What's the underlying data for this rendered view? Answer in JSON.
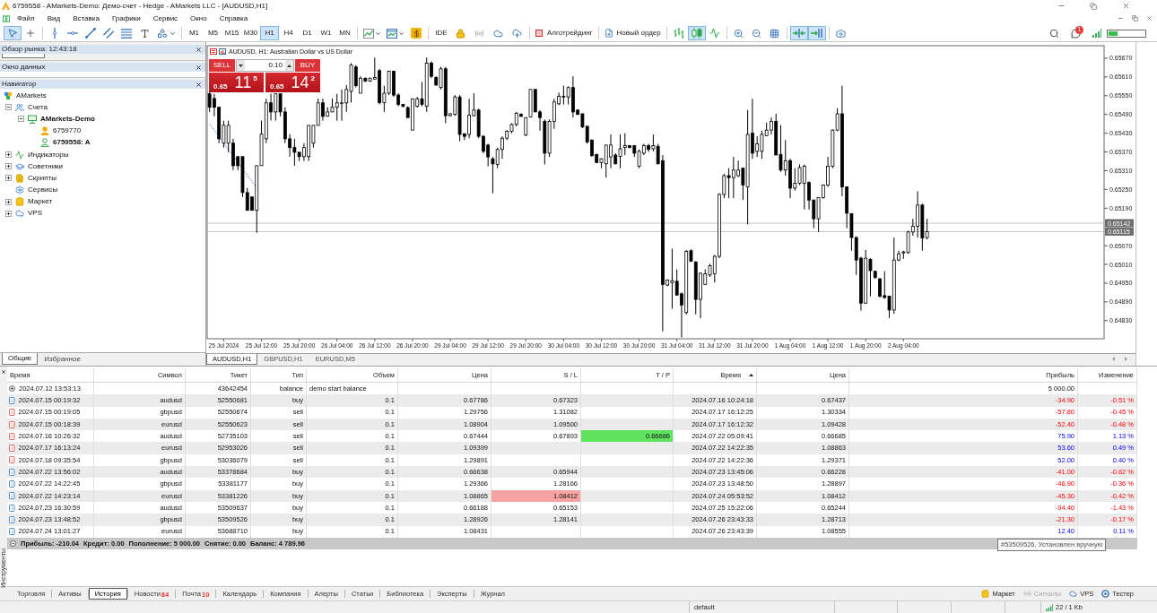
{
  "window": {
    "title": "6759558 - AMarkets-Demo: Демо-счет - Hedge - AMarkets LLC - [AUDUSD,H1]"
  },
  "menu": [
    "Файл",
    "Вид",
    "Вставка",
    "Графики",
    "Сервис",
    "Окно",
    "Справка"
  ],
  "toolbar": {
    "tools": [
      {
        "kind": "cursor",
        "selected": true
      },
      {
        "kind": "crosshair",
        "selected": false
      },
      {
        "kind": "vline",
        "selected": false
      },
      {
        "kind": "hline",
        "selected": false
      },
      {
        "kind": "trend",
        "selected": false
      },
      {
        "kind": "channel",
        "selected": false
      },
      {
        "kind": "fibo",
        "selected": false
      },
      {
        "kind": "text",
        "selected": false
      },
      {
        "kind": "shapes",
        "selected": false
      }
    ],
    "timeframes": [
      {
        "label": "M1",
        "selected": false
      },
      {
        "label": "M5",
        "selected": false
      },
      {
        "label": "M15",
        "selected": false
      },
      {
        "label": "M30",
        "selected": false
      },
      {
        "label": "H1",
        "selected": true
      },
      {
        "label": "H4",
        "selected": false
      },
      {
        "label": "D1",
        "selected": false
      },
      {
        "label": "W1",
        "selected": false
      },
      {
        "label": "MN",
        "selected": false
      }
    ],
    "ide": "IDE",
    "algo_trading": {
      "label": "Алготрейдинг",
      "on": false
    },
    "new_order": "Новый ордер",
    "chart_types": [
      {
        "kind": "bars",
        "selected": false
      },
      {
        "kind": "candles",
        "selected": true
      },
      {
        "kind": "line",
        "selected": false
      }
    ],
    "view_toggles": [
      {
        "kind": "autoscroll",
        "selected": true
      },
      {
        "kind": "shift",
        "selected": true
      }
    ],
    "notifications": "1"
  },
  "market_watch": {
    "title": "Обзор рынка: 12:43:18"
  },
  "data_window": {
    "title": "Окно данных"
  },
  "navigator": {
    "title": "Навигатор",
    "tree": [
      {
        "label": "AMarkets",
        "kind": "broker",
        "children": [
          {
            "label": "Счета",
            "kind": "accounts",
            "expanded": true,
            "children": [
              {
                "label": "AMarkets-Demo",
                "kind": "server",
                "expanded": true,
                "active": true,
                "children": [
                  {
                    "label": "6759770",
                    "kind": "account",
                    "active": false
                  },
                  {
                    "label": "6759558: A",
                    "kind": "account",
                    "active": true
                  }
                ]
              }
            ]
          },
          {
            "label": "Индикаторы",
            "kind": "indicators",
            "expanded": false
          },
          {
            "label": "Советники",
            "kind": "experts",
            "expanded": false
          },
          {
            "label": "Скрипты",
            "kind": "scripts",
            "expanded": false
          },
          {
            "label": "Сервисы",
            "kind": "services"
          },
          {
            "label": "Маркет",
            "kind": "market",
            "expanded": false
          },
          {
            "label": "VPS",
            "kind": "vps",
            "expanded": false
          }
        ]
      }
    ]
  },
  "left_tabs": [
    {
      "label": "Общие",
      "selected": true
    },
    {
      "label": "Избранное",
      "selected": false
    }
  ],
  "chart": {
    "one_click": {
      "sell": "SELL",
      "buy": "BUY",
      "lot": "0.10",
      "sell_price": {
        "head": "0.65",
        "big": "11",
        "tail": "5"
      },
      "buy_price": {
        "head": "0.65",
        "big": "14",
        "tail": "2"
      }
    },
    "chart_data": [
      {
        "type": "candlestick",
        "title": "AUDUSD, H1: Australian Dollar vs US Dollar",
        "ylim": [
          0.64772,
          0.6571
        ],
        "yticks": [
          {
            "value": 0.6567,
            "label": "0.65670"
          },
          {
            "value": 0.6561,
            "label": "0.65610"
          },
          {
            "value": 0.6555,
            "label": "0.65550"
          },
          {
            "value": 0.6549,
            "label": "0.65490"
          },
          {
            "value": 0.6543,
            "label": "0.65430"
          },
          {
            "value": 0.6537,
            "label": "0.65370"
          },
          {
            "value": 0.6531,
            "label": "0.65310"
          },
          {
            "value": 0.6525,
            "label": "0.65250"
          },
          {
            "value": 0.6519,
            "label": "0.65190"
          },
          {
            "value": 0.6507,
            "label": "0.65070"
          },
          {
            "value": 0.6501,
            "label": "0.65010"
          },
          {
            "value": 0.6495,
            "label": "0.64950"
          },
          {
            "value": 0.6489,
            "label": "0.64890"
          },
          {
            "value": 0.6483,
            "label": "0.64830"
          }
        ],
        "categories": [
          null,
          null,
          null,
          "25 Jul 2024",
          null,
          null,
          null,
          null,
          null,
          null,
          null,
          "25 Jul 12:00",
          null,
          null,
          null,
          null,
          null,
          null,
          null,
          "25 Jul 20:00",
          null,
          null,
          null,
          null,
          null,
          null,
          null,
          "26 Jul 04:00",
          null,
          null,
          null,
          null,
          null,
          null,
          null,
          "26 Jul 12:00",
          null,
          null,
          null,
          null,
          null,
          null,
          null,
          "26 Jul 20:00",
          null,
          null,
          null,
          null,
          null,
          null,
          null,
          "29 Jul 04:00",
          null,
          null,
          null,
          null,
          null,
          null,
          null,
          "29 Jul 12:00",
          null,
          null,
          null,
          null,
          null,
          null,
          null,
          "29 Jul 20:00",
          null,
          null,
          null,
          null,
          null,
          null,
          null,
          "30 Jul 04:00",
          null,
          null,
          null,
          null,
          null,
          null,
          null,
          "30 Jul 12:00",
          null,
          null,
          null,
          null,
          null,
          null,
          null,
          "30 Jul 20:00",
          null,
          null,
          null,
          null,
          null,
          null,
          null,
          "31 Jul 04:00",
          null,
          null,
          null,
          null,
          null,
          null,
          null,
          "31 Jul 12:00",
          null,
          null,
          null,
          null,
          null,
          null,
          null,
          "31 Jul 20:00",
          null,
          null,
          null,
          null,
          null,
          null,
          null,
          "1 Aug 04:00",
          null,
          null,
          null,
          null,
          null,
          null,
          null,
          "1 Aug 12:00",
          null,
          null,
          null,
          null,
          null,
          null,
          null,
          "1 Aug 20:00",
          null,
          null,
          null,
          null,
          null,
          null,
          null,
          "2 Aug 04:00",
          null,
          null,
          null,
          null,
          null,
          null,
          null,
          null,
          null,
          null,
          null,
          null,
          null,
          null,
          null,
          null,
          null,
          null,
          null,
          null,
          null,
          null,
          null,
          null,
          null,
          null,
          null,
          null,
          null,
          null,
          null,
          null,
          null,
          null,
          null,
          null,
          null,
          null,
          null,
          null,
          null,
          null
        ],
        "ohlc": [
          [
            0.65556,
            0.6557,
            0.65498,
            0.65513
          ],
          [
            0.65541,
            0.65556,
            0.65484,
            0.65513
          ],
          [
            0.65513,
            0.65513,
            0.65398,
            0.65412
          ],
          [
            0.65398,
            0.6547,
            0.65384,
            0.65455
          ],
          [
            0.65398,
            0.6547,
            0.65369,
            0.65455
          ],
          [
            0.65398,
            0.65412,
            0.65312,
            0.65326
          ],
          [
            0.65355,
            0.65355,
            0.65312,
            0.65326
          ],
          [
            0.65355,
            0.65355,
            0.65226,
            0.6524
          ],
          [
            0.6524,
            0.65255,
            0.65183,
            0.65183
          ],
          [
            0.65226,
            0.65226,
            0.65183,
            0.65183
          ],
          [
            0.65183,
            0.65326,
            0.65111,
            0.65326
          ],
          [
            0.65326,
            0.6547,
            0.65326,
            0.65427
          ],
          [
            0.65412,
            0.65541,
            0.65398,
            0.65527
          ],
          [
            0.65527,
            0.65556,
            0.6547,
            0.65498
          ],
          [
            0.65498,
            0.65556,
            0.6547,
            0.65556
          ],
          [
            0.65556,
            0.65556,
            0.65484,
            0.65498
          ],
          [
            0.65498,
            0.65513,
            0.65398,
            0.65412
          ],
          [
            0.65412,
            0.65427,
            0.65355,
            0.65384
          ],
          [
            0.65384,
            0.65412,
            0.65326,
            0.65369
          ],
          [
            0.65369,
            0.65369,
            0.65341,
            0.65355
          ],
          [
            0.65355,
            0.65398,
            0.65341,
            0.65384
          ],
          [
            0.65355,
            0.65455,
            0.65341,
            0.65455
          ],
          [
            0.65398,
            0.65455,
            0.65384,
            0.65455
          ],
          [
            0.65455,
            0.65541,
            0.65455,
            0.65527
          ],
          [
            0.65527,
            0.65541,
            0.6547,
            0.65484
          ],
          [
            0.65484,
            0.65513,
            0.65484,
            0.65498
          ],
          [
            0.65498,
            0.65541,
            0.65498,
            0.65513
          ],
          [
            0.65513,
            0.65556,
            0.6547,
            0.65527
          ],
          [
            0.65527,
            0.6557,
            0.6547,
            0.65527
          ],
          [
            0.65527,
            0.65584,
            0.65498,
            0.6557
          ],
          [
            0.65564,
            0.65654,
            0.65528,
            0.65648
          ],
          [
            0.65642,
            0.65648,
            0.65576,
            0.65582
          ],
          [
            0.65558,
            0.65612,
            0.65558,
            0.65606
          ],
          [
            0.65606,
            0.65608,
            0.65594,
            0.65597
          ],
          [
            0.65597,
            0.65608,
            0.65594,
            0.65606
          ],
          [
            0.65603,
            0.65672,
            0.65603,
            0.65608
          ],
          [
            0.6563,
            0.65636,
            0.65522,
            0.65528
          ],
          [
            0.65528,
            0.65582,
            0.65498,
            0.65558
          ],
          [
            0.65558,
            0.6563,
            0.65552,
            0.65628
          ],
          [
            0.65628,
            0.6563,
            0.65546,
            0.65552
          ],
          [
            0.65552,
            0.65558,
            0.65516,
            0.65522
          ],
          [
            0.65522,
            0.65524,
            0.65512,
            0.65516
          ],
          [
            0.65512,
            0.65516,
            0.6548,
            0.6548
          ],
          [
            0.6544,
            0.6554,
            0.6544,
            0.6554
          ],
          [
            0.65516,
            0.65546,
            0.65512,
            0.6554
          ],
          [
            0.6554,
            0.65594,
            0.65516,
            0.65522
          ],
          [
            0.65516,
            0.65672,
            0.65498,
            0.65654
          ],
          [
            0.65654,
            0.6566,
            0.65606,
            0.65612
          ],
          [
            0.65608,
            0.65612,
            0.65582,
            0.65584
          ],
          [
            0.65576,
            0.65642,
            0.6557,
            0.65636
          ],
          [
            0.65636,
            0.65642,
            0.65462,
            0.65486
          ],
          [
            0.65486,
            0.65494,
            0.65484,
            0.65492
          ],
          [
            0.6549,
            0.65552,
            0.65486,
            0.65546
          ],
          [
            0.65546,
            0.65552,
            0.65404,
            0.65426
          ],
          [
            0.65428,
            0.6543,
            0.65408,
            0.6542
          ],
          [
            0.65426,
            0.6554,
            0.65414,
            0.65488
          ],
          [
            0.65486,
            0.65558,
            0.65484,
            0.65504
          ],
          [
            0.65504,
            0.65508,
            0.65414,
            0.6542
          ],
          [
            0.6542,
            0.65424,
            0.65366,
            0.65372
          ],
          [
            0.65392,
            0.65396,
            0.65324,
            0.65354
          ],
          [
            0.65348,
            0.65354,
            0.65238,
            0.65332
          ],
          [
            0.6533,
            0.65384,
            0.65318,
            0.65378
          ],
          [
            0.65378,
            0.6542,
            0.65348,
            0.65414
          ],
          [
            0.65414,
            0.6544,
            0.65408,
            0.65436
          ],
          [
            0.65436,
            0.65462,
            0.6543,
            0.65458
          ],
          [
            0.65458,
            0.65498,
            0.65452,
            0.65494
          ],
          [
            0.6549,
            0.65494,
            0.65482,
            0.65484
          ],
          [
            0.65424,
            0.6548,
            0.6542,
            0.6548
          ],
          [
            0.65482,
            0.6557,
            0.6548,
            0.6557
          ],
          [
            0.6557,
            0.6557,
            0.65498,
            0.65498
          ],
          [
            0.65498,
            0.65504,
            0.65438,
            0.6548
          ],
          [
            0.65468,
            0.65474,
            0.6533,
            0.65366
          ],
          [
            0.65366,
            0.65474,
            0.65354,
            0.65468
          ],
          [
            0.65468,
            0.6554,
            0.65444,
            0.6553
          ],
          [
            0.65524,
            0.6556,
            0.6552,
            0.65548
          ],
          [
            0.65546,
            0.65582,
            0.65522,
            0.65548
          ],
          [
            0.65546,
            0.6558,
            0.65522,
            0.65576
          ],
          [
            0.65576,
            0.65612,
            0.6548,
            0.65498
          ],
          [
            0.65504,
            0.65506,
            0.65488,
            0.6549
          ],
          [
            0.65492,
            0.65494,
            0.65446,
            0.6545
          ],
          [
            0.65452,
            0.65454,
            0.65396,
            0.65402
          ],
          [
            0.65408,
            0.6541,
            0.65354,
            0.65358
          ],
          [
            0.65362,
            0.65364,
            0.65334,
            0.65336
          ],
          [
            0.65336,
            0.6535,
            0.65318,
            0.65348
          ],
          [
            0.65332,
            0.65392,
            0.65288,
            0.65392
          ],
          [
            0.65354,
            0.65426,
            0.65318,
            0.65392
          ],
          [
            0.6536,
            0.65366,
            0.6533,
            0.65332
          ],
          [
            0.65356,
            0.65426,
            0.65318,
            0.6538
          ],
          [
            0.65384,
            0.6543,
            0.6536,
            0.6539
          ],
          [
            0.6539,
            0.65392,
            0.65382,
            0.65384
          ],
          [
            0.6539,
            0.65392,
            0.65354,
            0.65366
          ],
          [
            0.65324,
            0.65378,
            0.65318,
            0.65372
          ],
          [
            0.65366,
            0.65396,
            0.6536,
            0.6539
          ],
          [
            0.6539,
            0.65396,
            0.6537,
            0.65378
          ],
          [
            0.6538,
            0.65426,
            0.65372,
            0.6539
          ],
          [
            0.65388,
            0.65396,
            0.6533,
            0.65332
          ],
          [
            0.65342,
            0.6536,
            0.64796,
            0.64946
          ],
          [
            0.64944,
            0.64962,
            0.6494,
            0.6496
          ],
          [
            0.64952,
            0.6506,
            0.64868,
            0.64958
          ],
          [
            0.64956,
            0.64994,
            0.6491,
            0.64912
          ],
          [
            0.64916,
            0.6492,
            0.64776,
            0.6488
          ],
          [
            0.64856,
            0.65056,
            0.6485,
            0.65052
          ],
          [
            0.65054,
            0.65058,
            0.65018,
            0.6502
          ],
          [
            0.65018,
            0.6502,
            0.6485,
            0.64898
          ],
          [
            0.64898,
            0.64984,
            0.64838,
            0.64982
          ],
          [
            0.64946,
            0.64994,
            0.64944,
            0.6498
          ],
          [
            0.64976,
            0.65012,
            0.6497,
            0.65006
          ],
          [
            0.6498,
            0.6504,
            0.64952,
            0.65036
          ],
          [
            0.65036,
            0.65238,
            0.6503,
            0.65234
          ],
          [
            0.65234,
            0.653,
            0.65222,
            0.65294
          ],
          [
            0.65294,
            0.65318,
            0.65222,
            0.65288
          ],
          [
            0.65288,
            0.65354,
            0.65222,
            0.65312
          ],
          [
            0.65294,
            0.65342,
            0.6529,
            0.65312
          ],
          [
            0.65318,
            0.6532,
            0.65216,
            0.65264
          ],
          [
            0.65258,
            0.65504,
            0.65138,
            0.65426
          ],
          [
            0.6543,
            0.6554,
            0.65348,
            0.65366
          ],
          [
            0.65372,
            0.6542,
            0.65354,
            0.65396
          ],
          [
            0.65372,
            0.65438,
            0.65348,
            0.65426
          ],
          [
            0.65422,
            0.65464,
            0.6542,
            0.6544
          ],
          [
            0.6544,
            0.6548,
            0.65426,
            0.65468
          ],
          [
            0.65468,
            0.65492,
            0.6536,
            0.6536
          ],
          [
            0.65362,
            0.65456,
            0.65306,
            0.65312
          ],
          [
            0.65312,
            0.65408,
            0.65294,
            0.65342
          ],
          [
            0.65342,
            0.65348,
            0.65222,
            0.65254
          ],
          [
            0.65254,
            0.65318,
            0.65246,
            0.6527
          ],
          [
            0.6527,
            0.6533,
            0.65264,
            0.6532
          ],
          [
            0.6527,
            0.6533,
            0.65186,
            0.65324
          ],
          [
            0.65272,
            0.65276,
            0.65186,
            0.65216
          ],
          [
            0.65216,
            0.65218,
            0.65126,
            0.65156
          ],
          [
            0.65156,
            0.65224,
            0.65114,
            0.65224
          ],
          [
            0.65224,
            0.65266,
            0.6522,
            0.65264
          ],
          [
            0.65264,
            0.65354,
            0.65258,
            0.65324
          ],
          [
            0.65324,
            0.65442,
            0.65318,
            0.6544
          ],
          [
            0.6544,
            0.6551,
            0.65436,
            0.65492
          ],
          [
            0.65492,
            0.65582,
            0.65228,
            0.65258
          ],
          [
            0.65258,
            0.6526,
            0.65126,
            0.65174
          ],
          [
            0.65172,
            0.65174,
            0.65054,
            0.65096
          ],
          [
            0.65096,
            0.651,
            0.64976,
            0.65024
          ],
          [
            0.6503,
            0.65034,
            0.64862,
            0.64886
          ],
          [
            0.64886,
            0.65056,
            0.64884,
            0.6503
          ],
          [
            0.65026,
            0.6503,
            0.64908,
            0.6499
          ],
          [
            0.64988,
            0.6499,
            0.64964,
            0.64968
          ],
          [
            0.64964,
            0.64966,
            0.64904,
            0.64908
          ],
          [
            0.6491,
            0.64988,
            0.649,
            0.64904
          ],
          [
            0.64908,
            0.6491,
            0.64838,
            0.64864
          ],
          [
            0.64864,
            0.65096,
            0.64852,
            0.65024
          ],
          [
            0.65024,
            0.65054,
            0.6502,
            0.65044
          ],
          [
            0.65047,
            0.65054,
            0.65028,
            0.6505
          ],
          [
            0.65048,
            0.65118,
            0.65044,
            0.65114
          ],
          [
            0.65114,
            0.65156,
            0.65102,
            0.65132
          ],
          [
            0.65132,
            0.65244,
            0.65096,
            0.652
          ],
          [
            0.652,
            0.65204,
            0.65054,
            0.65094
          ],
          [
            0.65096,
            0.65156,
            0.6509,
            0.65115
          ],
          null,
          null,
          null,
          null,
          null,
          null,
          null,
          null,
          null,
          null,
          null,
          null,
          null,
          null,
          null,
          null,
          null,
          null,
          null,
          null,
          null,
          null,
          null,
          null,
          null,
          null,
          null,
          null,
          null,
          null,
          null,
          null,
          null,
          null,
          null,
          null,
          null
        ],
        "series": [
          {
            "type": "line",
            "line_style": "dotted",
            "color": "#3f7fe0",
            "values": [
              0.6546,
              null,
              null,
              null,
              null,
              null,
              null,
              null,
              null,
              null,
              0.65255,
              null,
              null,
              null,
              null,
              null,
              null,
              null,
              null,
              null,
              null,
              null,
              null,
              null,
              null,
              null,
              null,
              null,
              null,
              null,
              null,
              null,
              null,
              null,
              null,
              null,
              null,
              null,
              null,
              null,
              null,
              null,
              null,
              null,
              null,
              null,
              null,
              null,
              null,
              null,
              null,
              null,
              null,
              null,
              null,
              null,
              null,
              null,
              null,
              null,
              null,
              null,
              null,
              null,
              null,
              null,
              null,
              null,
              null,
              null,
              null,
              null,
              null,
              null,
              null,
              null,
              null,
              null,
              null,
              null,
              null,
              null,
              null,
              null,
              null,
              null,
              null,
              null,
              null,
              null,
              null,
              null,
              null,
              null,
              null,
              null,
              null,
              null,
              null,
              null,
              null,
              null,
              null,
              null,
              null,
              null,
              null,
              null,
              null,
              null,
              null,
              null,
              null,
              null,
              null,
              null,
              null,
              null,
              null,
              null,
              null,
              null,
              null,
              null,
              null,
              null,
              null,
              null,
              null,
              null,
              null,
              null,
              null,
              null,
              null,
              null,
              null,
              null,
              null,
              null,
              null,
              null,
              null,
              null,
              null,
              null,
              null,
              null,
              null,
              null,
              null,
              null,
              null,
              null,
              null,
              null,
              null,
              null,
              null,
              null,
              null,
              null,
              null,
              null,
              null,
              null,
              null,
              null,
              null,
              null,
              null,
              null,
              null,
              null,
              null,
              null,
              null,
              null,
              null,
              null,
              null,
              null,
              null,
              null,
              null,
              null,
              null,
              null,
              null,
              null
            ]
          }
        ],
        "ref_lines": [
          {
            "axis": "y",
            "value": 0.65142,
            "label": "0.65142",
            "color": "#c4c4c4"
          },
          {
            "axis": "y",
            "value": 0.65115,
            "label": "0.65115",
            "color": "#c4c4c4"
          }
        ]
      }
    ],
    "tabs": [
      {
        "label": "AUDUSD,H1",
        "selected": true
      },
      {
        "label": "GBPUSD,H1",
        "selected": false
      },
      {
        "label": "EURUSD,M5",
        "selected": false
      }
    ]
  },
  "toolbox": {
    "label": "Инструменты",
    "history": {
      "columns": [
        {
          "label": "Время",
          "sorted": false
        },
        {
          "label": "Символ",
          "sorted": false
        },
        {
          "label": "Тикет",
          "sorted": false
        },
        {
          "label": "Тип",
          "sorted": false
        },
        {
          "label": "Объем",
          "sorted": false
        },
        {
          "label": "Цена",
          "sorted": false
        },
        {
          "label": "S / L",
          "sorted": false
        },
        {
          "label": "T / P",
          "sorted": false
        },
        {
          "label": "Время",
          "sorted": true
        },
        {
          "label": "Цена",
          "sorted": false
        },
        {
          "label": "Прибыль",
          "sorted": false
        },
        {
          "label": "Изменение",
          "sorted": false
        }
      ],
      "rows": [
        {
          "kind": "balance",
          "cells": [
            "2024.07.12 13:53:13",
            null,
            "43642454",
            "balance",
            "demo start balance",
            null,
            null,
            null,
            null,
            null,
            "5 000.00",
            null
          ],
          "sl_marked": false,
          "tp_marked": false
        },
        {
          "kind": "buy",
          "cells": [
            "2024.07.15 00:19:32",
            "audusd",
            "52550681",
            "buy",
            "0.1",
            "0.67786",
            "0.67323",
            null,
            "2024.07.16 10:24:18",
            "0.67437",
            "-34.90",
            "-0.51 %"
          ],
          "loss": true,
          "sl_marked": false,
          "tp_marked": false
        },
        {
          "kind": "sell",
          "cells": [
            "2024.07.15 00:19:05",
            "gbpusd",
            "52550674",
            "sell",
            "0.1",
            "1.29756",
            "1.31082",
            null,
            "2024.07.17 16:12:25",
            "1.30334",
            "-57.80",
            "-0.45 %"
          ],
          "loss": true,
          "sl_marked": false,
          "tp_marked": false
        },
        {
          "kind": "sell",
          "cells": [
            "2024.07.15 00:18:39",
            "eurusd",
            "52550623",
            "sell",
            "0.1",
            "1.08904",
            "1.09500",
            null,
            "2024.07.17 16:12:32",
            "1.09428",
            "-52.40",
            "-0.48 %"
          ],
          "loss": true,
          "sl_marked": false,
          "tp_marked": false
        },
        {
          "kind": "sell",
          "cells": [
            "2024.07.16 10:26:32",
            "audusd",
            "52735103",
            "sell",
            "0.1",
            "0.67444",
            "0.67893",
            "0.66686",
            "2024.07.22 05:09:41",
            "0.66685",
            "75.90",
            "1.13 %"
          ],
          "loss": false,
          "sl_marked": false,
          "tp_marked": true
        },
        {
          "kind": "sell",
          "cells": [
            "2024.07.17 16:13:24",
            "eurusd",
            "52953026",
            "sell",
            "0.1",
            "1.09399",
            null,
            null,
            "2024.07.22 14:22:35",
            "1.08863",
            "53.60",
            "0.49 %"
          ],
          "loss": false,
          "sl_marked": false,
          "tp_marked": false
        },
        {
          "kind": "sell",
          "cells": [
            "2024.07.18 09:35:54",
            "gbpusd",
            "53036079",
            "sell",
            "0.1",
            "1.29891",
            null,
            null,
            "2024.07.22 14:22:36",
            "1.29371",
            "52.00",
            "0.40 %"
          ],
          "loss": false,
          "sl_marked": false,
          "tp_marked": false
        },
        {
          "kind": "buy",
          "cells": [
            "2024.07.22 13:56:02",
            "audusd",
            "53378684",
            "buy",
            "0.1",
            "0.66638",
            "0.65944",
            null,
            "2024.07.23 13:45:06",
            "0.66228",
            "-41.00",
            "-0.62 %"
          ],
          "loss": true,
          "sl_marked": false,
          "tp_marked": false
        },
        {
          "kind": "buy",
          "cells": [
            "2024.07.22 14:22:45",
            "gbpusd",
            "53381177",
            "buy",
            "0.1",
            "1.29366",
            "1.28166",
            null,
            "2024.07.23 13:48:50",
            "1.28897",
            "-46.90",
            "-0.36 %"
          ],
          "loss": true,
          "sl_marked": false,
          "tp_marked": false
        },
        {
          "kind": "buy",
          "cells": [
            "2024.07.22 14:23:14",
            "eurusd",
            "53381226",
            "buy",
            "0.1",
            "1.08865",
            "1.08412",
            null,
            "2024.07.24 05:53:52",
            "1.08412",
            "-45.30",
            "-0.42 %"
          ],
          "loss": true,
          "sl_marked": true,
          "tp_marked": false
        },
        {
          "kind": "buy",
          "cells": [
            "2024.07.23 16:30:59",
            "audusd",
            "53509637",
            "buy",
            "0.1",
            "0.66188",
            "0.65153",
            null,
            "2024.07.25 15:22:06",
            "0.65244",
            "-94.40",
            "-1.43 %"
          ],
          "loss": true,
          "sl_marked": false,
          "tp_marked": false
        },
        {
          "kind": "buy",
          "cells": [
            "2024.07.23 13:48:52",
            "gbpusd",
            "53509526",
            "buy",
            "0.1",
            "1.28926",
            "1.28141",
            null,
            "2024.07.26 23:43:33",
            "1.28713",
            "-21.30",
            "-0.17 %"
          ],
          "loss": true,
          "sl_marked": false,
          "tp_marked": false
        },
        {
          "kind": "buy",
          "cells": [
            "2024.07.24 13:01:27",
            "eurusd",
            "53688710",
            "buy",
            "0.1",
            "1.08431",
            null,
            null,
            "2024.07.26 23:43:39",
            "1.08555",
            "12.40",
            "0.11 %"
          ],
          "loss": false,
          "sl_marked": false,
          "tp_marked": false
        }
      ],
      "summary": [
        "Прибыль: -210.04",
        "Кредит: 0.00",
        "Пополнение: 5 000.00",
        "Снятие: 0.00",
        "Баланс: 4 789.96"
      ]
    },
    "tooltip": "#53509526, Установлен вручную",
    "tabs": [
      {
        "label": "Торговля",
        "selected": false
      },
      {
        "label": "Активы",
        "selected": false
      },
      {
        "label": "История",
        "selected": true
      },
      {
        "label": "Новости",
        "selected": false,
        "badge": "84"
      },
      {
        "label": "Почта",
        "selected": false,
        "badge": "10"
      },
      {
        "label": "Календарь",
        "selected": false
      },
      {
        "label": "Компания",
        "selected": false
      },
      {
        "label": "Алерты",
        "selected": false
      },
      {
        "label": "Статьи",
        "selected": false
      },
      {
        "label": "Библиотека",
        "selected": false
      },
      {
        "label": "Эксперты",
        "selected": false
      },
      {
        "label": "Журнал",
        "selected": false
      }
    ],
    "services": [
      {
        "kind": "market",
        "label": "Маркет",
        "disabled": false
      },
      {
        "kind": "signals",
        "label": "Сигналы",
        "disabled": true
      },
      {
        "kind": "vps",
        "label": "VPS",
        "disabled": false
      },
      {
        "kind": "tester",
        "label": "Тестер",
        "disabled": false
      }
    ]
  },
  "status_bar": {
    "profile": "default",
    "traffic": "22 / 1 Kb"
  }
}
